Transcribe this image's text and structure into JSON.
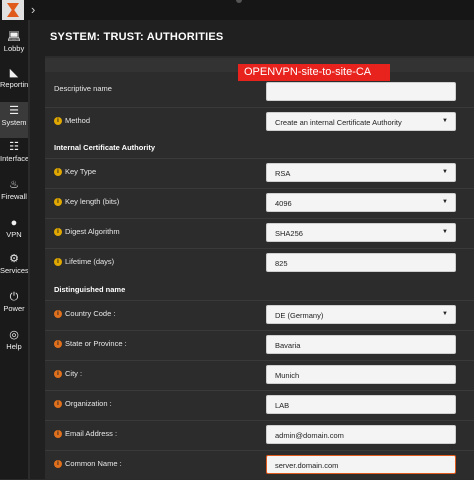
{
  "page": {
    "title": "SYSTEM: TRUST: AUTHORITIES"
  },
  "sidebar": {
    "items": [
      {
        "label": "Lobby",
        "icon": "laptop-icon"
      },
      {
        "label": "Reporting",
        "icon": "area-chart-icon"
      },
      {
        "label": "System",
        "icon": "server-icon"
      },
      {
        "label": "Interfaces",
        "icon": "sitemap-icon"
      },
      {
        "label": "Firewall",
        "icon": "fire-icon"
      },
      {
        "label": "VPN",
        "icon": "globe-icon"
      },
      {
        "label": "Services",
        "icon": "gears-icon"
      },
      {
        "label": "Power",
        "icon": "plug-icon"
      },
      {
        "label": "Help",
        "icon": "lifebuoy-icon"
      }
    ]
  },
  "form": {
    "descriptive_name": {
      "label": "Descriptive name",
      "value": "OPENVPN-site-to-site-CA"
    },
    "method": {
      "label": "Method",
      "value": "Create an internal Certificate Authority"
    },
    "section_ica": "Internal Certificate Authority",
    "key_type": {
      "label": "Key Type",
      "value": "RSA"
    },
    "key_length": {
      "label": "Key length (bits)",
      "value": "4096"
    },
    "digest": {
      "label": "Digest Algorithm",
      "value": "SHA256"
    },
    "lifetime": {
      "label": "Lifetime (days)",
      "value": "825"
    },
    "section_dn": "Distinguished name",
    "country": {
      "label": "Country Code :",
      "value": "DE (Germany)"
    },
    "state": {
      "label": "State or Province :",
      "value": "Bavaria"
    },
    "city": {
      "label": "City :",
      "value": "Munich"
    },
    "org": {
      "label": "Organization :",
      "value": "LAB"
    },
    "email": {
      "label": "Email Address :",
      "value": "admin@domain.com"
    },
    "cn": {
      "label": "Common Name :",
      "value": "server.domain.com"
    }
  },
  "colors": {
    "accent": "#e05a1c",
    "highlight": "#e8231e",
    "info": "#e0a800"
  }
}
